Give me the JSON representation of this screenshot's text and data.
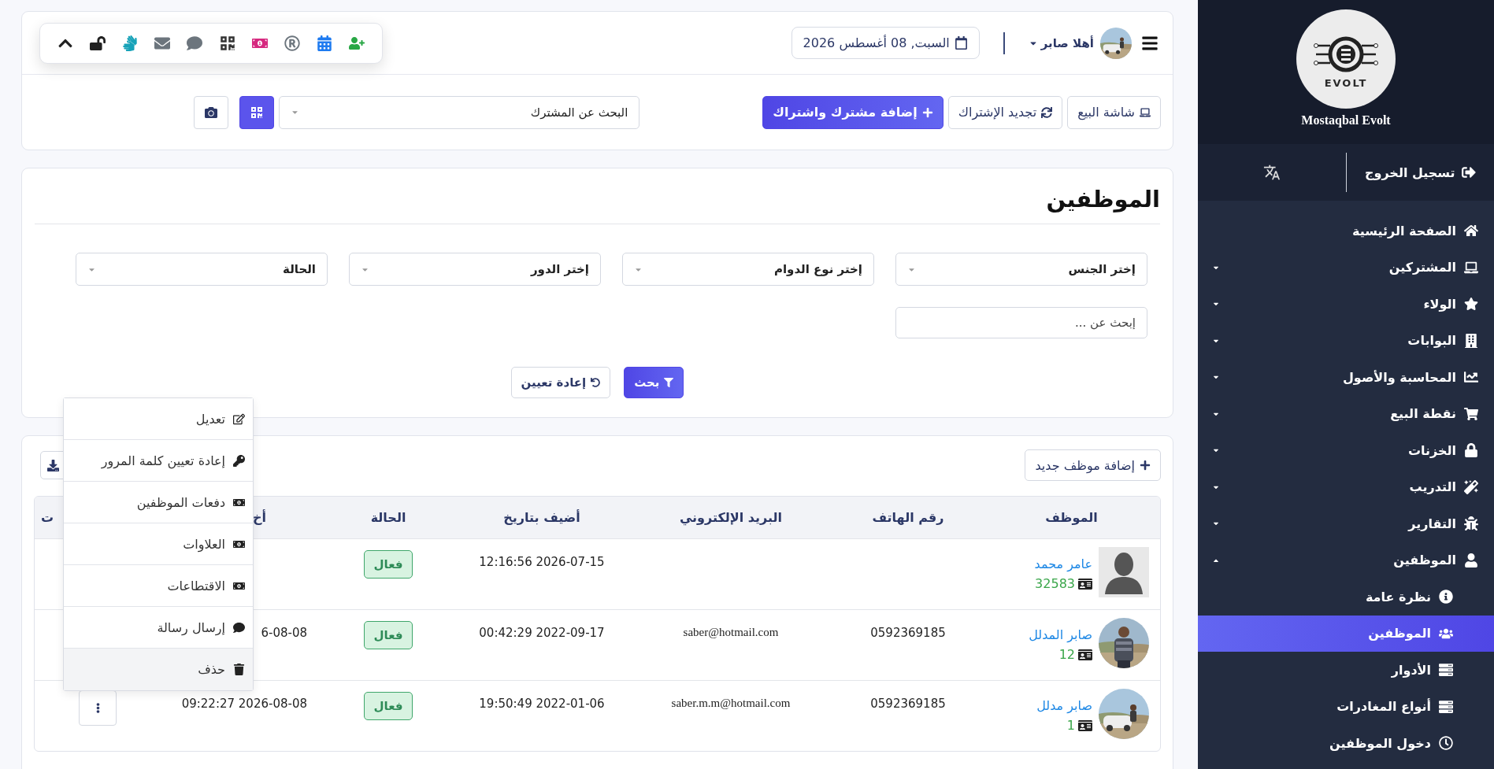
{
  "header": {
    "greeting": "أهلا صابر",
    "date": "السبت, 08 أغسطس 2026"
  },
  "quick_actions": [
    {
      "label": "شاشة البيع",
      "kind": "outline"
    },
    {
      "label": "تجديد الإشتراك",
      "kind": "outline"
    },
    {
      "label": "إضافة مشترك واشتراك",
      "kind": "primary"
    }
  ],
  "subscriber_search": {
    "placeholder": "البحث عن المشترك"
  },
  "filters": {
    "title": "الموظفين",
    "selects": [
      {
        "placeholder": "إختر الجنس"
      },
      {
        "placeholder": "إختر نوع الدوام"
      },
      {
        "placeholder": "إختر الدور"
      },
      {
        "placeholder": "الحالة"
      }
    ],
    "search": {
      "placeholder": "إبحث عن ..."
    },
    "buttons": [
      {
        "label": "بحث",
        "kind": "primary"
      },
      {
        "label": "إعادة تعيين",
        "kind": "outline"
      }
    ]
  },
  "employees": {
    "add_button": "إضافة موظف جديد",
    "columns": [
      "الموظف",
      "رقم الهاتف",
      "البريد الإلكتروني",
      "أضيف بتاريخ",
      "الحالة",
      "أخ",
      "ت"
    ],
    "rows": [
      {
        "avatar": {
          "kind": "placeholder"
        },
        "name": "عامر محمد",
        "id": "32583",
        "added": "2026-07-15 12:16:56",
        "status": "فعال"
      },
      {
        "name": "صابر المدلل",
        "id": "12",
        "phone": "0592369185",
        "email": "saber@hotmail.com",
        "added": "2022-09-17 00:42:29",
        "status": "فعال",
        "column_6": "6-08-08"
      },
      {
        "name": "صابر مدلل",
        "id": "1",
        "phone": "0592369185",
        "email": "saber.m.m@hotmail.com",
        "added": "2022-01-06 19:50:49",
        "status": "فعال",
        "column_6": "2026-08-08 09:22:27"
      }
    ]
  },
  "row_menu": {
    "items": [
      {
        "label": "تعديل",
        "highlighted": false
      },
      {
        "label": "إعادة تعيين كلمة المرور",
        "highlighted": false
      },
      {
        "label": "دفعات الموظفين",
        "highlighted": false
      },
      {
        "label": "العلاوات",
        "highlighted": false
      },
      {
        "label": "الاقتطاعات",
        "highlighted": false
      },
      {
        "label": "إرسال رسالة",
        "highlighted": false
      },
      {
        "label": "حذف",
        "highlighted": true
      }
    ]
  },
  "sidebar": {
    "logo_text": "EVOLT",
    "brand": "Mostaqbal Evolt",
    "logout": "تسجيل الخروج",
    "items": [
      {
        "label": "الصفحة الرئيسية",
        "kind": "link"
      },
      {
        "label": "المشتركين",
        "kind": "group",
        "expanded": false
      },
      {
        "label": "الولاء",
        "kind": "group",
        "expanded": false
      },
      {
        "label": "البوابات",
        "kind": "group",
        "expanded": false
      },
      {
        "label": "المحاسبة والأصول",
        "kind": "group",
        "expanded": false
      },
      {
        "label": "نقطة البيع",
        "kind": "group",
        "expanded": false
      },
      {
        "label": "الخزنات",
        "kind": "group",
        "expanded": false
      },
      {
        "label": "التدريب",
        "kind": "group",
        "expanded": false
      },
      {
        "label": "التقارير",
        "kind": "group",
        "expanded": false
      },
      {
        "label": "الموظفين",
        "kind": "group",
        "expanded": true,
        "children": [
          {
            "label": "نظرة عامة",
            "selected": false
          },
          {
            "label": "الموظفين",
            "selected": true
          },
          {
            "label": "الأدوار",
            "selected": false
          },
          {
            "label": "أنواع المغادرات",
            "selected": false
          },
          {
            "label": "دخول الموظفين",
            "selected": false
          }
        ]
      }
    ]
  }
}
